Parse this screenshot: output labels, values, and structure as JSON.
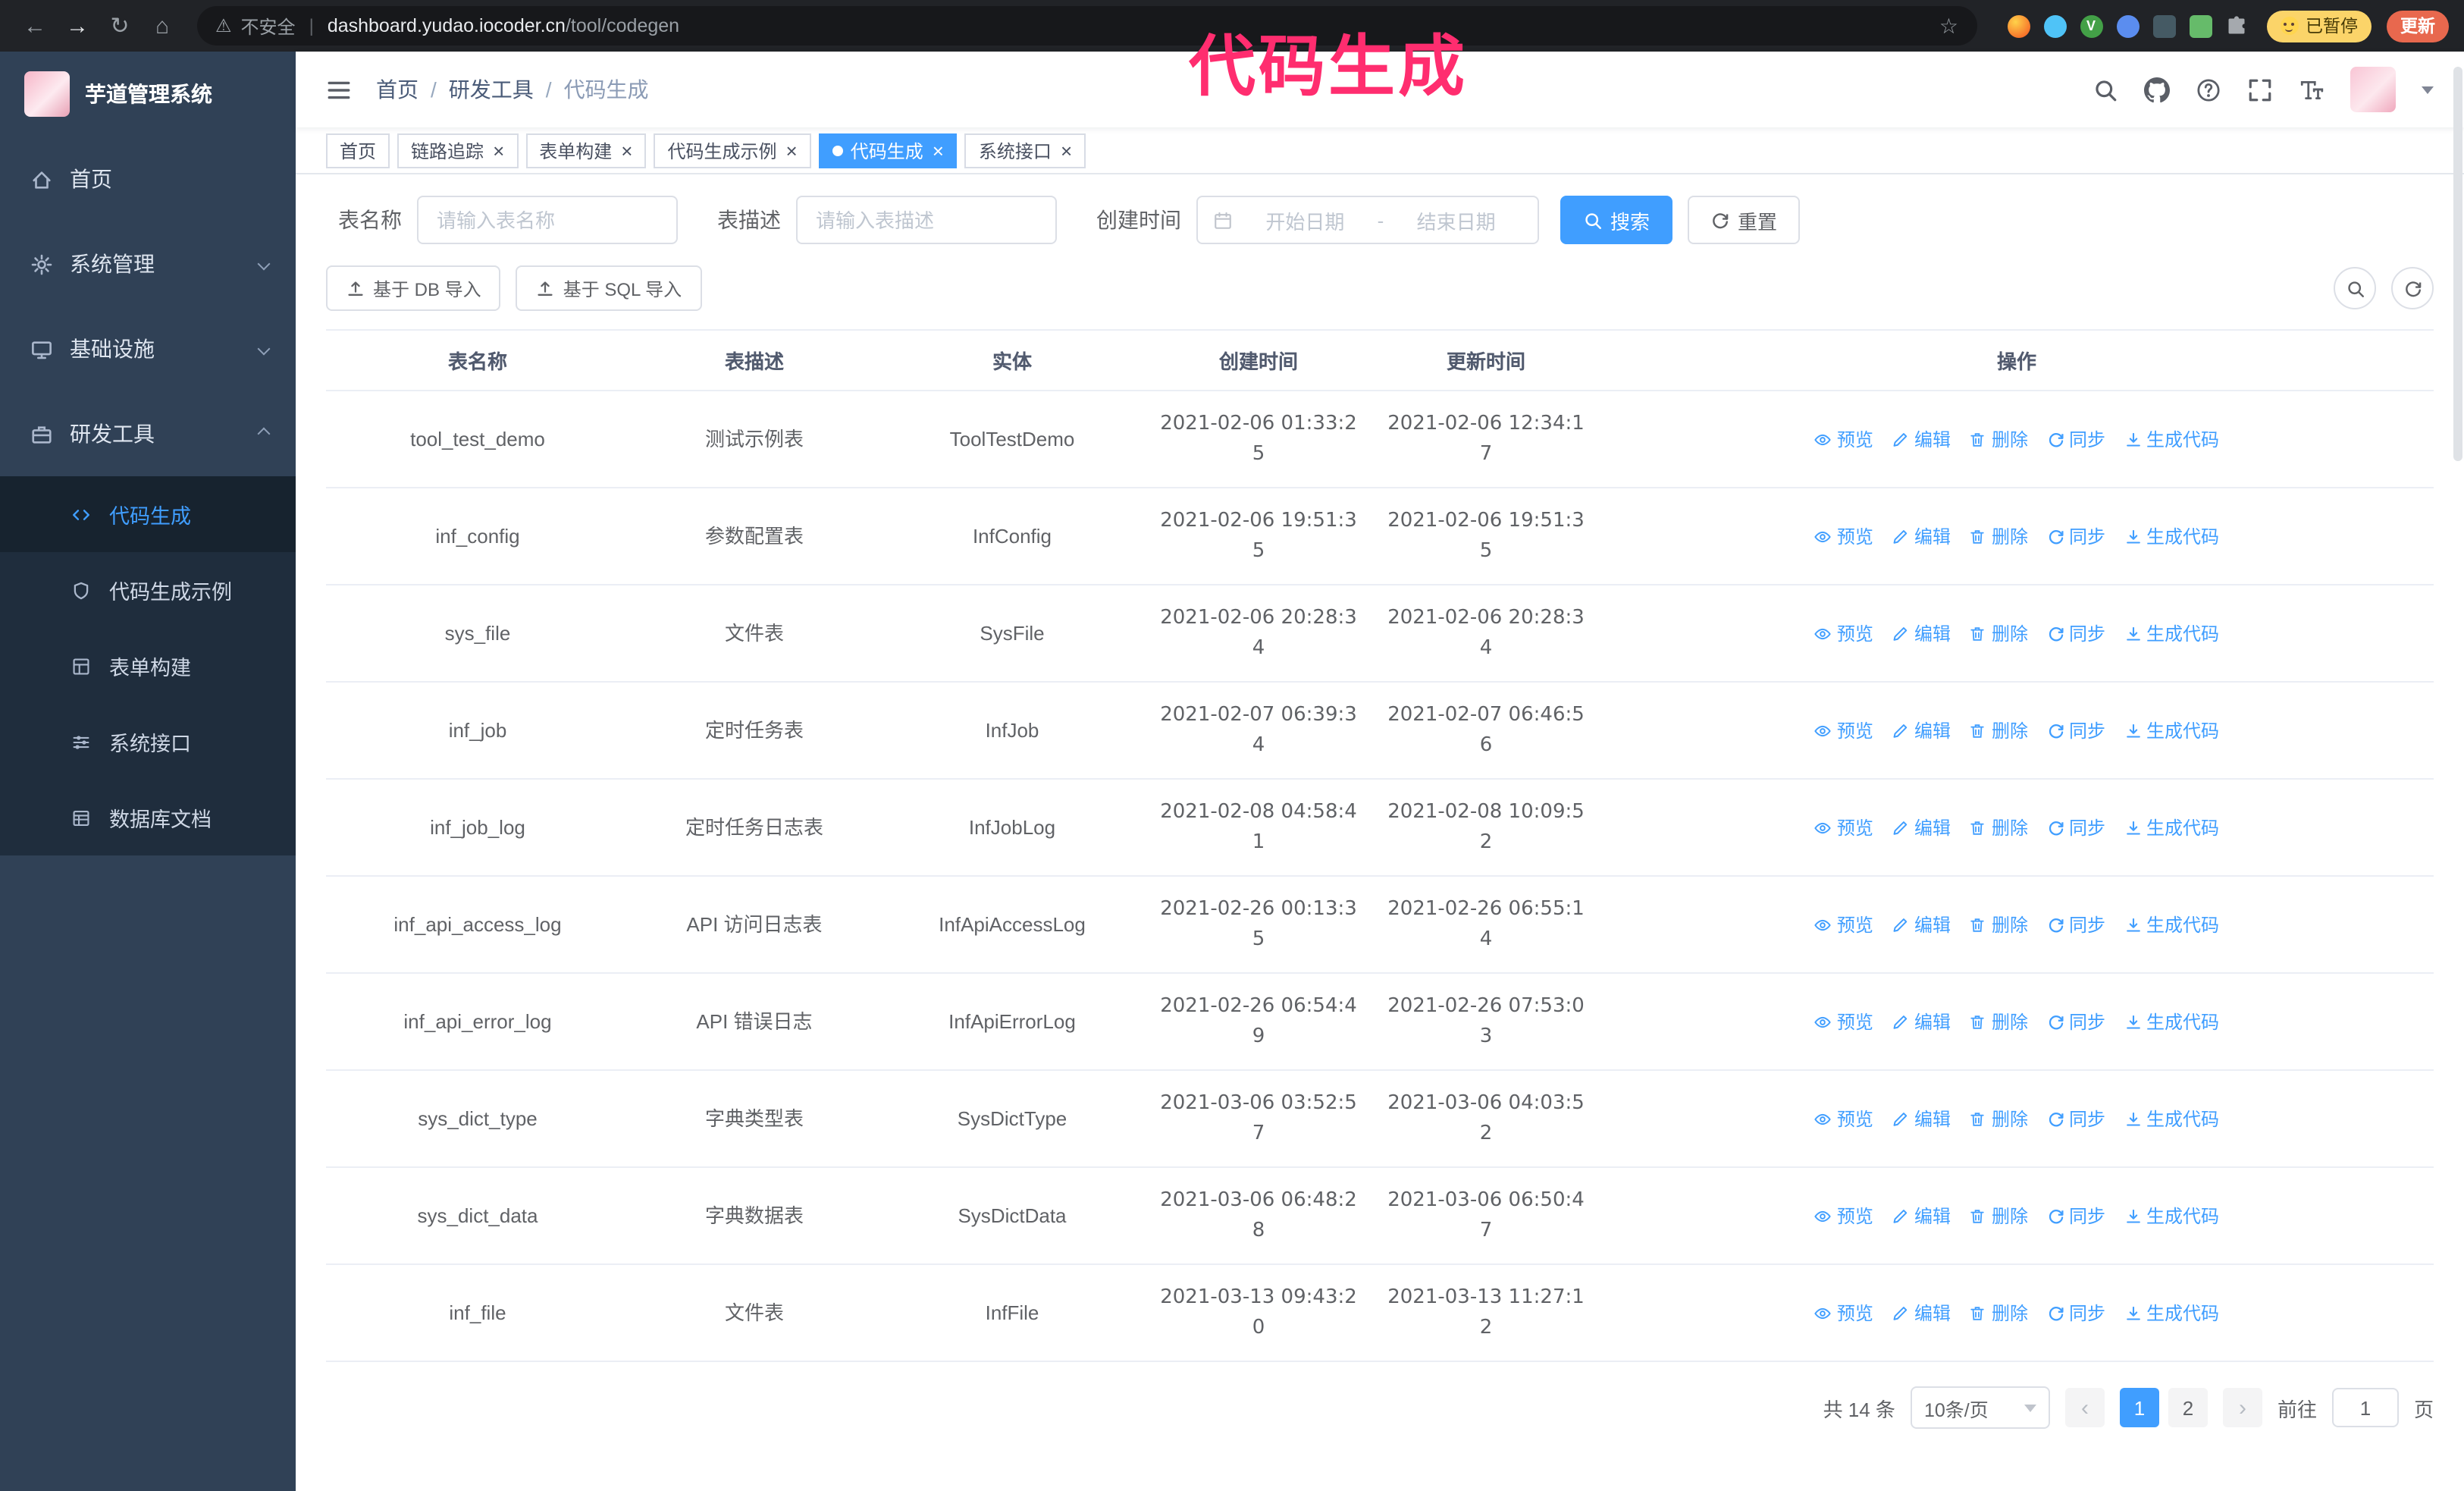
{
  "colors": {
    "accent": "#409eff",
    "sidebar-bg": "#304156",
    "submenu-bg": "#1f2d3d",
    "annotation": "#ff2d6f"
  },
  "browser": {
    "security_label": "不安全",
    "url_host": "dashboard.yudao.iocoder.cn",
    "url_path": "/tool/codegen",
    "paused_badge": "已暂停",
    "update_button": "更新"
  },
  "annotation": {
    "text": "代码生成"
  },
  "sidebar": {
    "logo_title": "芋道管理系统",
    "items": [
      {
        "label": "首页",
        "icon": "home-icon",
        "chevron": null,
        "active": false
      },
      {
        "label": "系统管理",
        "icon": "gear-icon",
        "chevron": "down",
        "active": false
      },
      {
        "label": "基础设施",
        "icon": "monitor-icon",
        "chevron": "down",
        "active": false
      },
      {
        "label": "研发工具",
        "icon": "tools-icon",
        "chevron": "up",
        "active": true
      }
    ],
    "submenu": [
      {
        "label": "代码生成",
        "icon": "code-icon",
        "active": true
      },
      {
        "label": "代码生成示例",
        "icon": "shield-icon",
        "active": false
      },
      {
        "label": "表单构建",
        "icon": "form-icon",
        "active": false
      },
      {
        "label": "系统接口",
        "icon": "api-icon",
        "active": false
      },
      {
        "label": "数据库文档",
        "icon": "dbdoc-icon",
        "active": false
      }
    ]
  },
  "header": {
    "breadcrumb": [
      "首页",
      "研发工具",
      "代码生成"
    ]
  },
  "tabs": [
    {
      "label": "首页",
      "closable": false,
      "active": false
    },
    {
      "label": "链路追踪",
      "closable": true,
      "active": false
    },
    {
      "label": "表单构建",
      "closable": true,
      "active": false
    },
    {
      "label": "代码生成示例",
      "closable": true,
      "active": false
    },
    {
      "label": "代码生成",
      "closable": true,
      "active": true
    },
    {
      "label": "系统接口",
      "closable": true,
      "active": false
    }
  ],
  "filters": {
    "name_label": "表名称",
    "name_placeholder": "请输入表名称",
    "desc_label": "表描述",
    "desc_placeholder": "请输入表描述",
    "time_label": "创建时间",
    "start_placeholder": "开始日期",
    "separator": "-",
    "end_placeholder": "结束日期",
    "search_button": "搜索",
    "reset_button": "重置"
  },
  "toolbar": {
    "import_db": "基于 DB 导入",
    "import_sql": "基于 SQL 导入"
  },
  "table": {
    "columns": [
      "表名称",
      "表描述",
      "实体",
      "创建时间",
      "更新时间",
      "操作"
    ],
    "actions": [
      {
        "name": "preview-action",
        "label": "预览",
        "icon": "eye-icon"
      },
      {
        "name": "edit-action",
        "label": "编辑",
        "icon": "edit-icon"
      },
      {
        "name": "delete-action",
        "label": "删除",
        "icon": "delete-icon"
      },
      {
        "name": "sync-action",
        "label": "同步",
        "icon": "sync-icon"
      },
      {
        "name": "generate-code-action",
        "label": "生成代码",
        "icon": "generate-icon"
      }
    ],
    "rows": [
      {
        "name": "tool_test_demo",
        "desc": "测试示例表",
        "entity": "ToolTestDemo",
        "created": "2021-02-06 01:33:25",
        "updated": "2021-02-06 12:34:17"
      },
      {
        "name": "inf_config",
        "desc": "参数配置表",
        "entity": "InfConfig",
        "created": "2021-02-06 19:51:35",
        "updated": "2021-02-06 19:51:35"
      },
      {
        "name": "sys_file",
        "desc": "文件表",
        "entity": "SysFile",
        "created": "2021-02-06 20:28:34",
        "updated": "2021-02-06 20:28:34"
      },
      {
        "name": "inf_job",
        "desc": "定时任务表",
        "entity": "InfJob",
        "created": "2021-02-07 06:39:34",
        "updated": "2021-02-07 06:46:56"
      },
      {
        "name": "inf_job_log",
        "desc": "定时任务日志表",
        "entity": "InfJobLog",
        "created": "2021-02-08 04:58:41",
        "updated": "2021-02-08 10:09:52"
      },
      {
        "name": "inf_api_access_log",
        "desc": "API 访问日志表",
        "entity": "InfApiAccessLog",
        "created": "2021-02-26 00:13:35",
        "updated": "2021-02-26 06:55:14"
      },
      {
        "name": "inf_api_error_log",
        "desc": "API 错误日志",
        "entity": "InfApiErrorLog",
        "created": "2021-02-26 06:54:49",
        "updated": "2021-02-26 07:53:03"
      },
      {
        "name": "sys_dict_type",
        "desc": "字典类型表",
        "entity": "SysDictType",
        "created": "2021-03-06 03:52:57",
        "updated": "2021-03-06 04:03:52"
      },
      {
        "name": "sys_dict_data",
        "desc": "字典数据表",
        "entity": "SysDictData",
        "created": "2021-03-06 06:48:28",
        "updated": "2021-03-06 06:50:47"
      },
      {
        "name": "inf_file",
        "desc": "文件表",
        "entity": "InfFile",
        "created": "2021-03-13 09:43:20",
        "updated": "2021-03-13 11:27:12"
      }
    ]
  },
  "pagination": {
    "total": "共 14 条",
    "page_size": "10条/页",
    "pages": [
      "1",
      "2"
    ],
    "active_page": "1",
    "goto_label": "前往",
    "goto_value": "1",
    "goto_unit": "页"
  }
}
